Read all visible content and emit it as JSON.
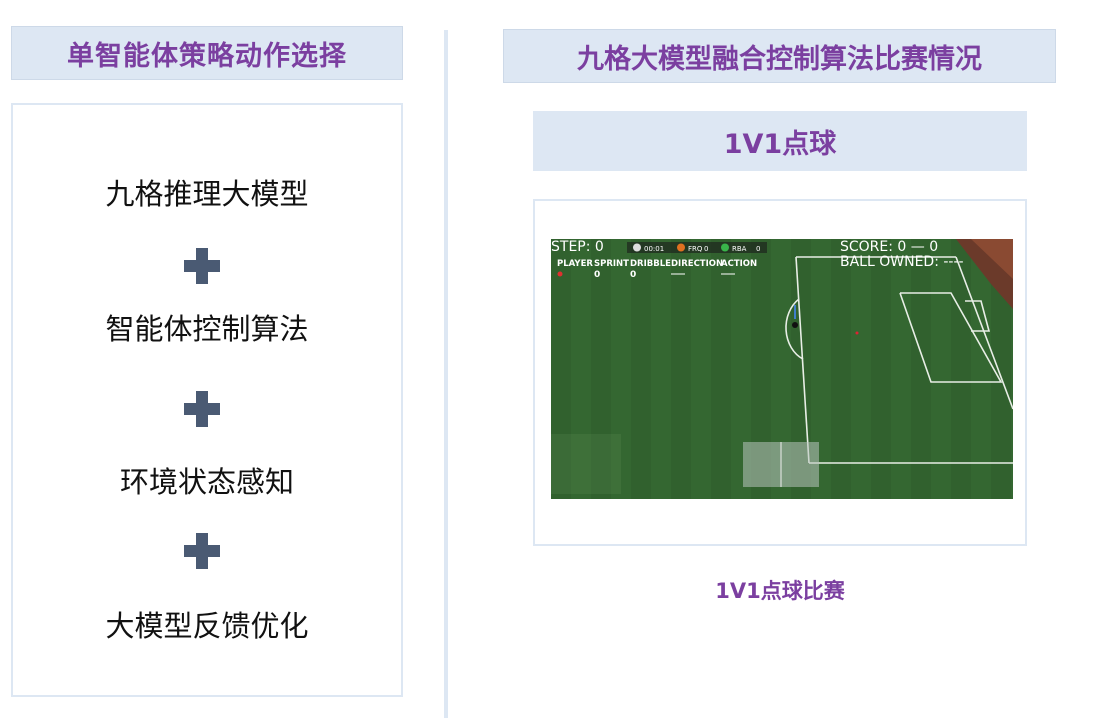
{
  "left": {
    "header": "单智能体策略动作选择",
    "items": [
      "九格推理大模型",
      "智能体控制算法",
      "环境状态感知",
      "大模型反馈优化"
    ],
    "plus_icon": "plus-icon"
  },
  "right": {
    "header": "九格大模型融合控制算法比赛情况",
    "subheader": "1V1点球",
    "caption": "1V1点球比赛",
    "game": {
      "step": "STEP: 0",
      "score": "SCORE: 0 — 0",
      "ball_owned": "BALL OWNED: ----",
      "columns": [
        "PLAYER",
        "SPRINT",
        "DRIBBLE",
        "DIRECTION",
        "ACTION"
      ],
      "values": [
        "0",
        "0"
      ],
      "clock": "00:01",
      "team_a": "FRQ",
      "team_a_score": "0",
      "team_b": "RBA",
      "team_b_score": "0"
    }
  },
  "colors": {
    "accent": "#7b3fa0",
    "header_bg": "#dde7f3",
    "plus": "#4a5a73",
    "pitch": "#2f6a2e"
  }
}
